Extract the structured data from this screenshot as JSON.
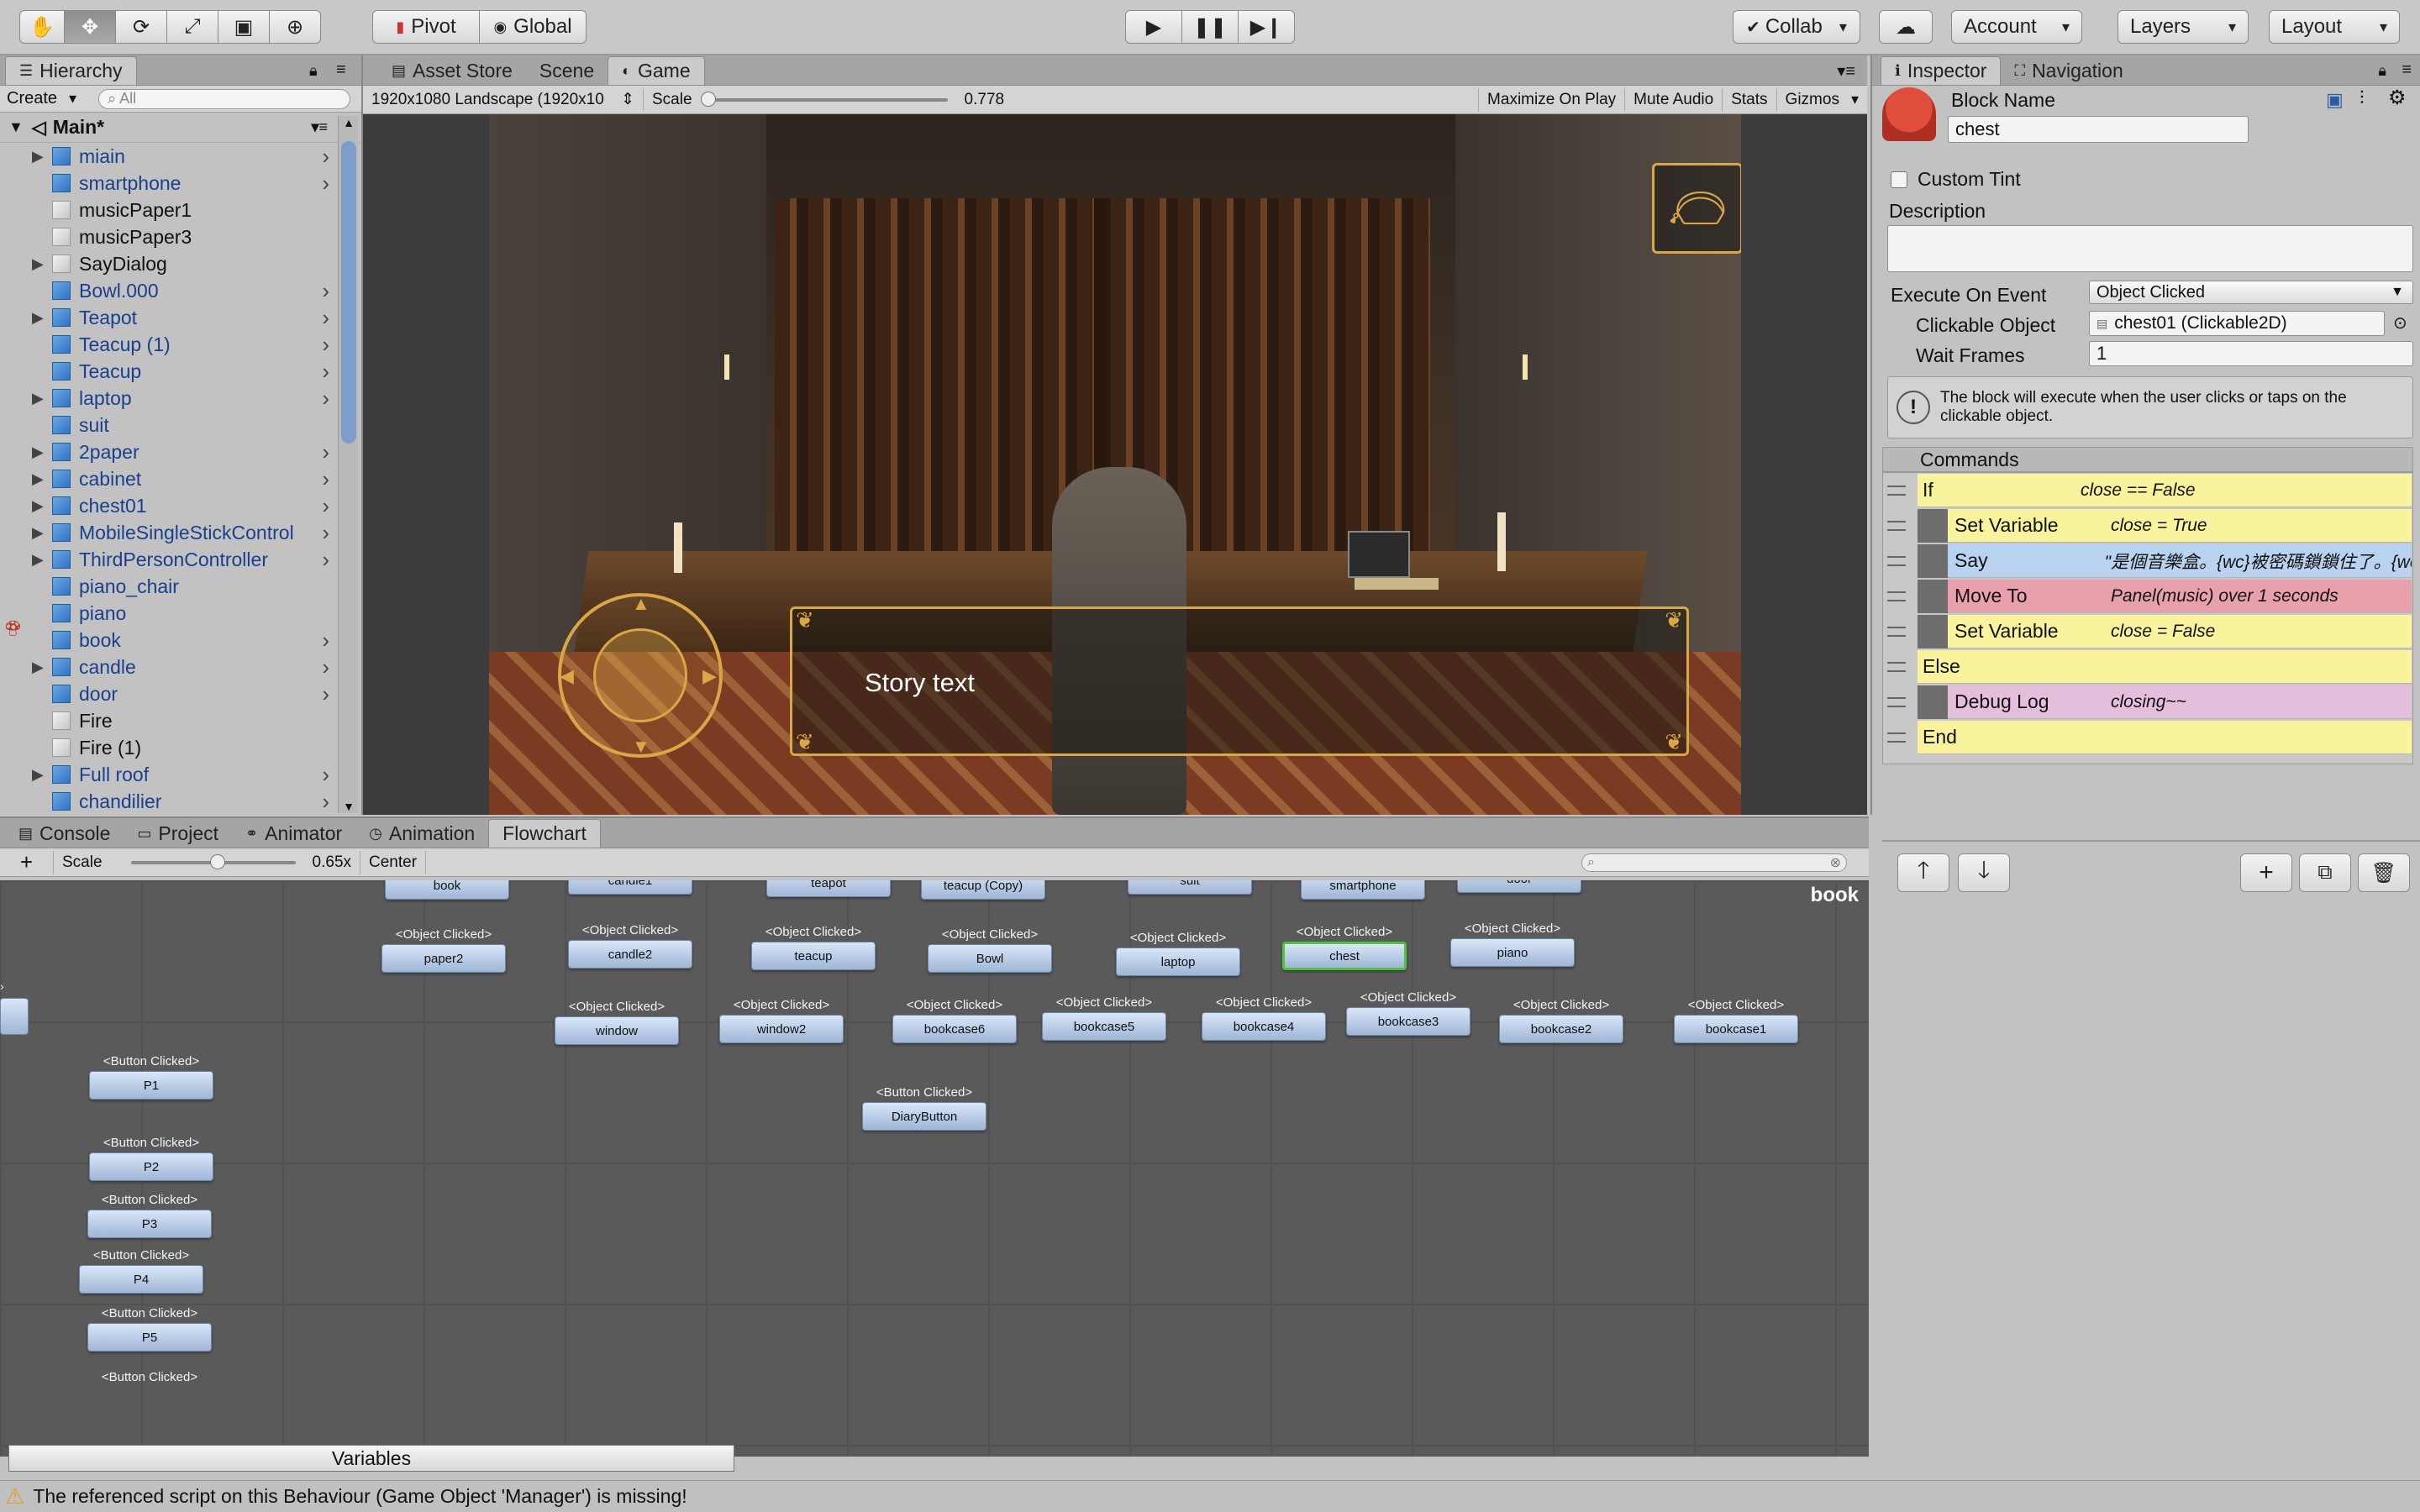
{
  "toolbar": {
    "tools": [
      "hand-icon",
      "move-icon",
      "rotate-icon",
      "scale-icon",
      "rect-icon",
      "transform-icon"
    ],
    "pivot": "Pivot",
    "global": "Global",
    "collab": "Collab",
    "account": "Account",
    "layers": "Layers",
    "layout": "Layout"
  },
  "hierarchy": {
    "tab": "Hierarchy",
    "create": "Create",
    "search_placeholder": "All",
    "scene": "Main*",
    "items": [
      {
        "label": "miain",
        "type": "blue",
        "arrow": true,
        "chev": true
      },
      {
        "label": "smartphone",
        "type": "blue",
        "arrow": false,
        "chev": true
      },
      {
        "label": "musicPaper1",
        "type": "gray",
        "arrow": false,
        "chev": false
      },
      {
        "label": "musicPaper3",
        "type": "gray",
        "arrow": false,
        "chev": false
      },
      {
        "label": "SayDialog",
        "type": "gray",
        "arrow": true,
        "chev": false
      },
      {
        "label": "Bowl.000",
        "type": "blue",
        "arrow": false,
        "chev": true
      },
      {
        "label": "Teapot",
        "type": "blue",
        "arrow": true,
        "chev": true
      },
      {
        "label": "Teacup (1)",
        "type": "blue",
        "arrow": false,
        "chev": true
      },
      {
        "label": "Teacup",
        "type": "blue",
        "arrow": false,
        "chev": true
      },
      {
        "label": "laptop",
        "type": "blue",
        "arrow": true,
        "chev": true
      },
      {
        "label": "suit",
        "type": "blue",
        "arrow": false,
        "chev": false
      },
      {
        "label": "2paper",
        "type": "blue",
        "arrow": true,
        "chev": true
      },
      {
        "label": "cabinet",
        "type": "blue",
        "arrow": true,
        "chev": true
      },
      {
        "label": "chest01",
        "type": "blue",
        "arrow": true,
        "chev": true
      },
      {
        "label": "MobileSingleStickControl",
        "type": "blue",
        "arrow": true,
        "chev": true
      },
      {
        "label": "ThirdPersonController",
        "type": "blue",
        "arrow": true,
        "chev": true
      },
      {
        "label": "piano_chair",
        "type": "blue",
        "arrow": false,
        "chev": false
      },
      {
        "label": "piano",
        "type": "blue",
        "arrow": false,
        "chev": false
      },
      {
        "label": "book",
        "type": "blue",
        "arrow": false,
        "chev": true
      },
      {
        "label": "candle",
        "type": "blue",
        "arrow": true,
        "chev": true
      },
      {
        "label": "door",
        "type": "blue",
        "arrow": false,
        "chev": true
      },
      {
        "label": "Fire",
        "type": "gray",
        "arrow": false,
        "chev": false
      },
      {
        "label": "Fire (1)",
        "type": "gray",
        "arrow": false,
        "chev": false
      },
      {
        "label": "Full roof",
        "type": "blue",
        "arrow": true,
        "chev": true
      },
      {
        "label": "chandilier",
        "type": "blue",
        "arrow": false,
        "chev": true
      }
    ]
  },
  "center_tabs": [
    "Asset Store",
    "Scene",
    "Game"
  ],
  "game": {
    "resolution": "1920x1080 Landscape (1920x10",
    "scale_label": "Scale",
    "scale_value": "0.778",
    "maximize": "Maximize On Play",
    "mute": "Mute Audio",
    "stats": "Stats",
    "gizmos": "Gizmos",
    "story_text": "Story text"
  },
  "bottom_tabs": [
    "Console",
    "Project",
    "Animator",
    "Animation",
    "Flowchart"
  ],
  "flowchart": {
    "add": "+",
    "scale_label": "Scale",
    "scale_value": "0.65x",
    "center": "Center",
    "selected_label": "book",
    "variables": "Variables",
    "nodes": [
      {
        "ev": "<Object Clicked>",
        "name": "book"
      },
      {
        "ev": "<Object Clicked>",
        "name": "candle1"
      },
      {
        "ev": "<Object Clicked>",
        "name": "teapot"
      },
      {
        "ev": "<Object Clicked>",
        "name": "teacup (Copy)"
      },
      {
        "ev": "<Object Clicked>",
        "name": "suit"
      },
      {
        "ev": "<Object Clicked>",
        "name": "smartphone"
      },
      {
        "ev": "<Object Clicked>",
        "name": "door"
      },
      {
        "ev": "<Object Clicked>",
        "name": "paper2"
      },
      {
        "ev": "<Object Clicked>",
        "name": "candle2"
      },
      {
        "ev": "<Object Clicked>",
        "name": "teacup"
      },
      {
        "ev": "<Object Clicked>",
        "name": "Bowl"
      },
      {
        "ev": "<Object Clicked>",
        "name": "laptop"
      },
      {
        "ev": "<Object Clicked>",
        "name": "chest",
        "selected": true
      },
      {
        "ev": "<Object Clicked>",
        "name": "piano"
      },
      {
        "ev": "<Object Clicked>",
        "name": "window"
      },
      {
        "ev": "<Object Clicked>",
        "name": "window2"
      },
      {
        "ev": "<Object Clicked>",
        "name": "bookcase6"
      },
      {
        "ev": "<Object Clicked>",
        "name": "bookcase5"
      },
      {
        "ev": "<Object Clicked>",
        "name": "bookcase4"
      },
      {
        "ev": "<Object Clicked>",
        "name": "bookcase3"
      },
      {
        "ev": "<Object Clicked>",
        "name": "bookcase2"
      },
      {
        "ev": "<Object Clicked>",
        "name": "bookcase1"
      },
      {
        "ev": "<Button Clicked>",
        "name": "DiaryButton"
      },
      {
        "ev": "<Button Clicked>",
        "name": "P1"
      },
      {
        "ev": "<Button Clicked>",
        "name": "P2"
      },
      {
        "ev": "<Button Clicked>",
        "name": "P3"
      },
      {
        "ev": "<Button Clicked>",
        "name": "P4"
      },
      {
        "ev": "<Button Clicked>",
        "name": "P5"
      },
      {
        "ev": "<Button Clicked>",
        "name": ""
      }
    ]
  },
  "inspector": {
    "tab": "Inspector",
    "nav_tab": "Navigation",
    "block_name_label": "Block Name",
    "block_name": "chest",
    "custom_tint": "Custom Tint",
    "description": "Description",
    "execute_label": "Execute On Event",
    "execute_value": "Object Clicked",
    "clickable_label": "Clickable Object",
    "clickable_value": "chest01 (Clickable2D)",
    "wait_label": "Wait Frames",
    "wait_value": "1",
    "help": "The block will execute when the user clicks or taps on the clickable object.",
    "commands_header": "Commands",
    "commands": [
      {
        "name": "If",
        "param": "close == False",
        "color": "#f8f39c",
        "indent": 0
      },
      {
        "name": "Set Variable",
        "param": "close = True",
        "color": "#f8f39c",
        "indent": 1
      },
      {
        "name": "Say",
        "param": "\"是個音樂盒。{wc}被密碼鎖鎖住了。{wc}",
        "color": "#b8d2ef",
        "indent": 1
      },
      {
        "name": "Move To",
        "param": "Panel(music) over 1 seconds",
        "color": "#e8a1ac",
        "indent": 1
      },
      {
        "name": "Set Variable",
        "param": "close = False",
        "color": "#f8f39c",
        "indent": 1
      },
      {
        "name": "Else",
        "param": "",
        "color": "#f8f39c",
        "indent": 0
      },
      {
        "name": "Debug Log",
        "param": "closing~~",
        "color": "#e3bfdc",
        "indent": 1
      },
      {
        "name": "End",
        "param": "",
        "color": "#f8f39c",
        "indent": 0
      }
    ]
  },
  "status": {
    "message": "The referenced script on this Behaviour (Game Object 'Manager') is missing!"
  },
  "colors": {
    "accent_selected": "#4ec43e",
    "flowchart_bg": "#5a5a5a",
    "command_if": "#f8f39c",
    "command_say": "#b8d2ef",
    "command_move": "#e8a1ac",
    "command_log": "#e3bfdc"
  }
}
